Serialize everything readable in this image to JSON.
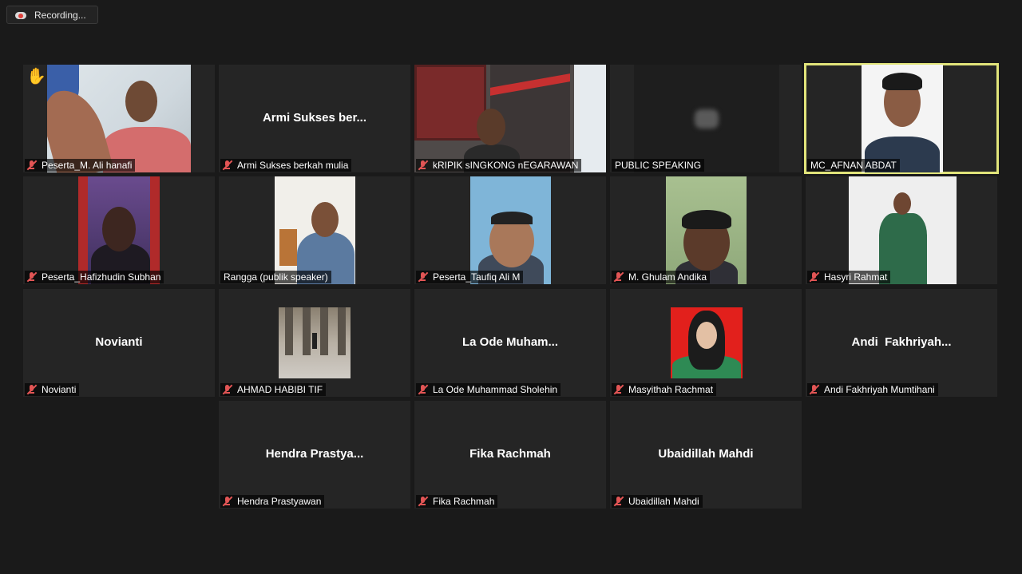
{
  "recording": {
    "label": "Recording..."
  },
  "hand_icon": "✋",
  "tiles": [
    {
      "label": "Peserta_M. Ali hanafi",
      "display": ""
    },
    {
      "label": "Armi Sukses berkah mulia",
      "display": "Armi Sukses ber..."
    },
    {
      "label": "kRIPIK sINGKONG nEGARAWAN",
      "display": ""
    },
    {
      "label": "PUBLIC SPEAKING",
      "display": ""
    },
    {
      "label": "MC_AFNAN ABDAT",
      "display": ""
    },
    {
      "label": "Peserta_Hafizhudin Subhan",
      "display": ""
    },
    {
      "label": "Rangga (publik speaker)",
      "display": ""
    },
    {
      "label": "Peserta_Taufiq Ali M",
      "display": ""
    },
    {
      "label": "M. Ghulam Andika",
      "display": ""
    },
    {
      "label": "Hasyri Rahmat",
      "display": ""
    },
    {
      "label": "Novianti",
      "display": "Novianti"
    },
    {
      "label": "AHMAD HABIBI TIF",
      "display": ""
    },
    {
      "label": "La Ode Muhammad Sholehin",
      "display": "La Ode Muham..."
    },
    {
      "label": "Masyithah Rachmat",
      "display": ""
    },
    {
      "label": "Andi Fakhriyah Mumtihani",
      "display": "Andi  Fakhriyah..."
    },
    {
      "label": "Hendra Prastyawan",
      "display": "Hendra Prastya..."
    },
    {
      "label": "Fika Rachmah",
      "display": "Fika Rachmah"
    },
    {
      "label": "Ubaidillah Mahdi",
      "display": "Ubaidillah Mahdi"
    }
  ],
  "colors": {
    "active_speaker_border": "#e1e47a",
    "muted_mic": "#e25555",
    "background": "#1a1a1a",
    "tile": "#252525"
  }
}
